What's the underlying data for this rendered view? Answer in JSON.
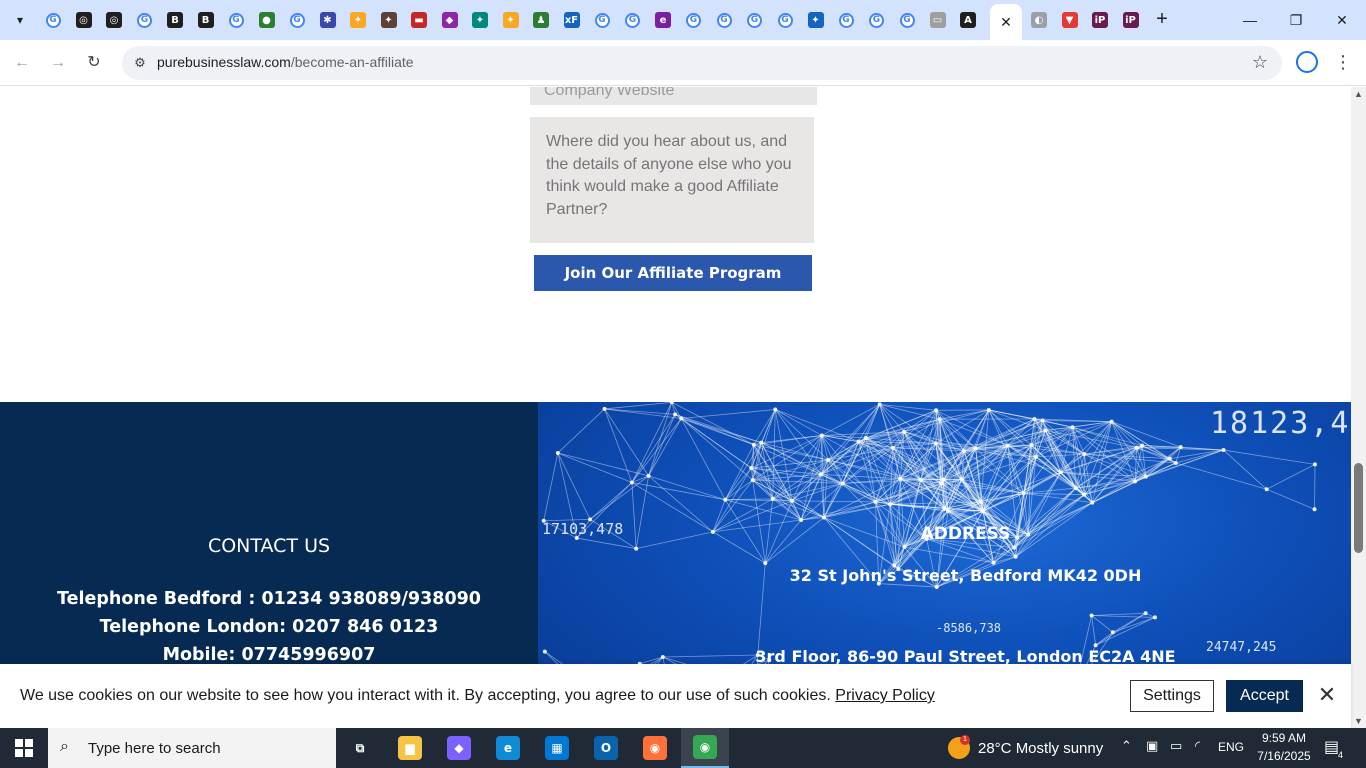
{
  "browser": {
    "url_host": "purebusinesslaw.com",
    "url_path": "/become-an-affiliate",
    "tabs": [
      {
        "icon": "google-icon",
        "letter": "G",
        "color": "#4285f4"
      },
      {
        "icon": "openai-icon",
        "letter": "◎",
        "color": "#1f1f1f"
      },
      {
        "icon": "openai-icon",
        "letter": "◎",
        "color": "#1f1f1f"
      },
      {
        "icon": "google-icon",
        "letter": "G",
        "color": "#4285f4"
      },
      {
        "icon": "b-icon",
        "letter": "B",
        "color": "#1f1f1f"
      },
      {
        "icon": "b-icon",
        "letter": "B",
        "color": "#1f1f1f"
      },
      {
        "icon": "google-icon",
        "letter": "G",
        "color": "#4285f4"
      },
      {
        "icon": "globe-icon",
        "letter": "●",
        "color": "#2e7d32"
      },
      {
        "icon": "google-icon",
        "letter": "G",
        "color": "#4285f4"
      },
      {
        "icon": "app-icon",
        "letter": "✱",
        "color": "#3949ab"
      },
      {
        "icon": "app-icon",
        "letter": "✦",
        "color": "#f9a825"
      },
      {
        "icon": "app-icon",
        "letter": "✦",
        "color": "#5d4037"
      },
      {
        "icon": "app-icon",
        "letter": "▬",
        "color": "#c62828"
      },
      {
        "icon": "app-icon",
        "letter": "◆",
        "color": "#8e24aa"
      },
      {
        "icon": "app-icon",
        "letter": "✦",
        "color": "#00897b"
      },
      {
        "icon": "app-icon",
        "letter": "✦",
        "color": "#f9a825"
      },
      {
        "icon": "app-icon",
        "letter": "♟",
        "color": "#2e7d32"
      },
      {
        "icon": "xf-icon",
        "letter": "xF",
        "color": "#1565c0"
      },
      {
        "icon": "google-icon",
        "letter": "G",
        "color": "#4285f4"
      },
      {
        "icon": "google-icon",
        "letter": "G",
        "color": "#4285f4"
      },
      {
        "icon": "app-icon",
        "letter": "e",
        "color": "#7b1fa2"
      },
      {
        "icon": "google-icon",
        "letter": "G",
        "color": "#4285f4"
      },
      {
        "icon": "google-icon",
        "letter": "G",
        "color": "#4285f4"
      },
      {
        "icon": "google-icon",
        "letter": "G",
        "color": "#4285f4"
      },
      {
        "icon": "google-icon",
        "letter": "G",
        "color": "#4285f4"
      },
      {
        "icon": "app-icon",
        "letter": "✦",
        "color": "#1565c0"
      },
      {
        "icon": "google-icon",
        "letter": "G",
        "color": "#4285f4"
      },
      {
        "icon": "google-icon",
        "letter": "G",
        "color": "#4285f4"
      },
      {
        "icon": "google-icon",
        "letter": "G",
        "color": "#4285f4"
      },
      {
        "icon": "app-icon",
        "letter": "▭",
        "color": "#9e9e9e"
      },
      {
        "icon": "a-icon",
        "letter": "A",
        "color": "#1f1f1f"
      }
    ],
    "after_tabs": [
      {
        "icon": "globe-icon",
        "letter": "◐",
        "color": "#9aa0a6"
      },
      {
        "icon": "app-icon",
        "letter": "▼",
        "color": "#e53935"
      },
      {
        "icon": "ip-icon",
        "letter": "iP",
        "color": "#6a1b4d"
      },
      {
        "icon": "ip-icon",
        "letter": "iP",
        "color": "#6a1b4d"
      }
    ]
  },
  "form": {
    "company_website_placeholder": "Company Website",
    "hear_about_placeholder": "Where did you hear about us, and the details of anyone else who you think would make a good Affiliate Partner?",
    "submit_label": "Join Our Affiliate Program"
  },
  "footer": {
    "contact_heading": "CONTACT US",
    "contact_lines": [
      "Telephone Bedford : 01234 938089/938090",
      "Telephone London: 0207 846 0123",
      "Mobile: 07745996907"
    ],
    "address_heading": "ADDRESS",
    "address_lines": [
      "32 St John's Street, Bedford MK42 0DH",
      "3rd Floor, 86-90 Paul Street, London EC2A 4NE"
    ],
    "background_numbers": [
      "18123,4",
      "17103,478",
      "-8586,738",
      "24747,245"
    ]
  },
  "cookie": {
    "text": "We use cookies on our website to see how you interact with it. By accepting, you agree to our use of such cookies.",
    "privacy_link": "Privacy Policy",
    "settings_label": "Settings",
    "accept_label": "Accept"
  },
  "taskbar": {
    "search_placeholder": "Type here to search",
    "weather_temp": "28°C",
    "weather_desc": "Mostly sunny",
    "weather_badge": "1",
    "language": "ENG",
    "time": "9:59 AM",
    "date": "7/16/2025",
    "notification_count": "4",
    "apps": [
      {
        "name": "task-view",
        "glyph": "⧉",
        "color": "#1f2a36"
      },
      {
        "name": "file-explorer",
        "glyph": "▆",
        "color": "#f6c343"
      },
      {
        "name": "copilot",
        "glyph": "◆",
        "color": "#7b61ff"
      },
      {
        "name": "edge",
        "glyph": "e",
        "color": "#0f8bd6"
      },
      {
        "name": "microsoft-store",
        "glyph": "▦",
        "color": "#0078d4"
      },
      {
        "name": "outlook",
        "glyph": "O",
        "color": "#0a64ad"
      },
      {
        "name": "firefox",
        "glyph": "◉",
        "color": "#ff7139"
      },
      {
        "name": "chrome",
        "glyph": "◉",
        "color": "#34a853"
      }
    ]
  },
  "colors": {
    "tabstrip": "#d3e3fd",
    "submit_blue": "#2b57ad",
    "footer_navy": "#062a52",
    "accept_navy": "#062a52"
  }
}
